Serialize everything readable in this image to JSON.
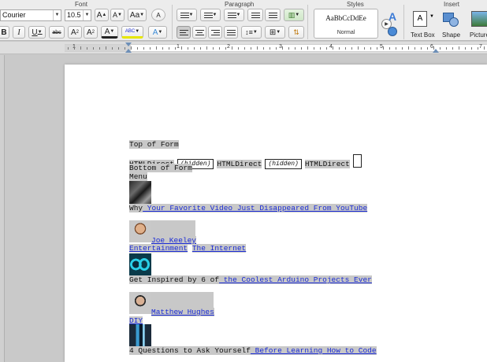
{
  "ribbon": {
    "groups": {
      "font": "Font",
      "paragraph": "Paragraph",
      "styles": "Styles",
      "insert": "Insert"
    },
    "font_name": "Courier",
    "font_size": "10.5",
    "grow_font": "A",
    "shrink_font": "A",
    "change_case": "Aa",
    "clear_format": "A",
    "bold": "B",
    "italic": "I",
    "underline": "U",
    "strikethrough": "abc",
    "superscript": "A",
    "subscript": "A",
    "text_color": "A",
    "highlight": "ABC",
    "text_effects": "A",
    "style_sample": "AaBbCcDdEe",
    "style_name": "Normal",
    "styles_pane": "A",
    "text_box": "Text Box",
    "shape": "Shape",
    "picture": "Picture"
  },
  "ruler": {
    "numbers": [
      "1",
      "1",
      "2",
      "3",
      "4",
      "5",
      "6",
      "7"
    ]
  },
  "document": {
    "top_of_form": "Top of Form",
    "htmldirect_1": "HTMLDirect",
    "hidden_1": "(hidden)",
    "htmldirect_2": "HTMLDirect",
    "hidden_2": "(hidden)",
    "htmldirect_3": "HTMLDirect",
    "bottom_of_form": "Bottom of Form",
    "menu": "Menu",
    "article1_prefix": "Why",
    "article1_link": " Your Favorite Video Just Disappeared From YouTube",
    "author1": "Joe Keeley",
    "category1a": "Entertainment",
    "category1b": "The Internet",
    "article2_prefix": "Get Inspired by 6 of",
    "article2_link": " the Coolest Arduino Projects Ever",
    "author2": "Matthew Hughes",
    "category2": "DIY",
    "article3_prefix": "4 Questions to Ask Yourself",
    "article3_link": " Before Learning How to Code"
  },
  "colors": {
    "link": "#1a2bd6",
    "field_shading": "#c8c8c8",
    "indent_marker": "#6d8fb7"
  }
}
